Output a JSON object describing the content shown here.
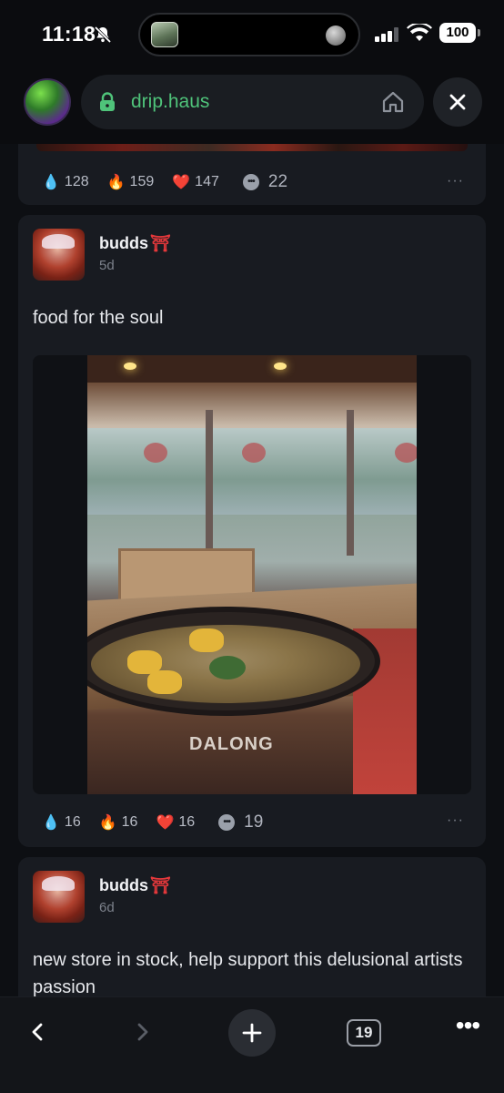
{
  "status_bar": {
    "time": "11:18",
    "battery": "100"
  },
  "browser": {
    "url": "drip.haus"
  },
  "feed": {
    "previous_post": {
      "reactions": {
        "drop": "128",
        "fire": "159",
        "heart": "147",
        "comments": "22"
      }
    },
    "posts": [
      {
        "author": "budds",
        "author_badge": "⛩",
        "time": "5d",
        "text": "food for the soul",
        "image_caption": "DALONG",
        "reactions": {
          "drop": "16",
          "fire": "16",
          "heart": "16",
          "comments": "19"
        }
      },
      {
        "author": "budds",
        "author_badge": "⛩",
        "time": "6d",
        "text": "new store in stock, help support this delusional artists passion"
      }
    ]
  },
  "toolbar": {
    "tab_count": "19"
  },
  "icons": {
    "drop": "💧",
    "fire": "🔥",
    "heart": "❤️",
    "comment": "•••",
    "more": "···"
  },
  "colors": {
    "accent_green": "#4fc37a",
    "background": "#0d0f13",
    "card": "#181b21"
  }
}
